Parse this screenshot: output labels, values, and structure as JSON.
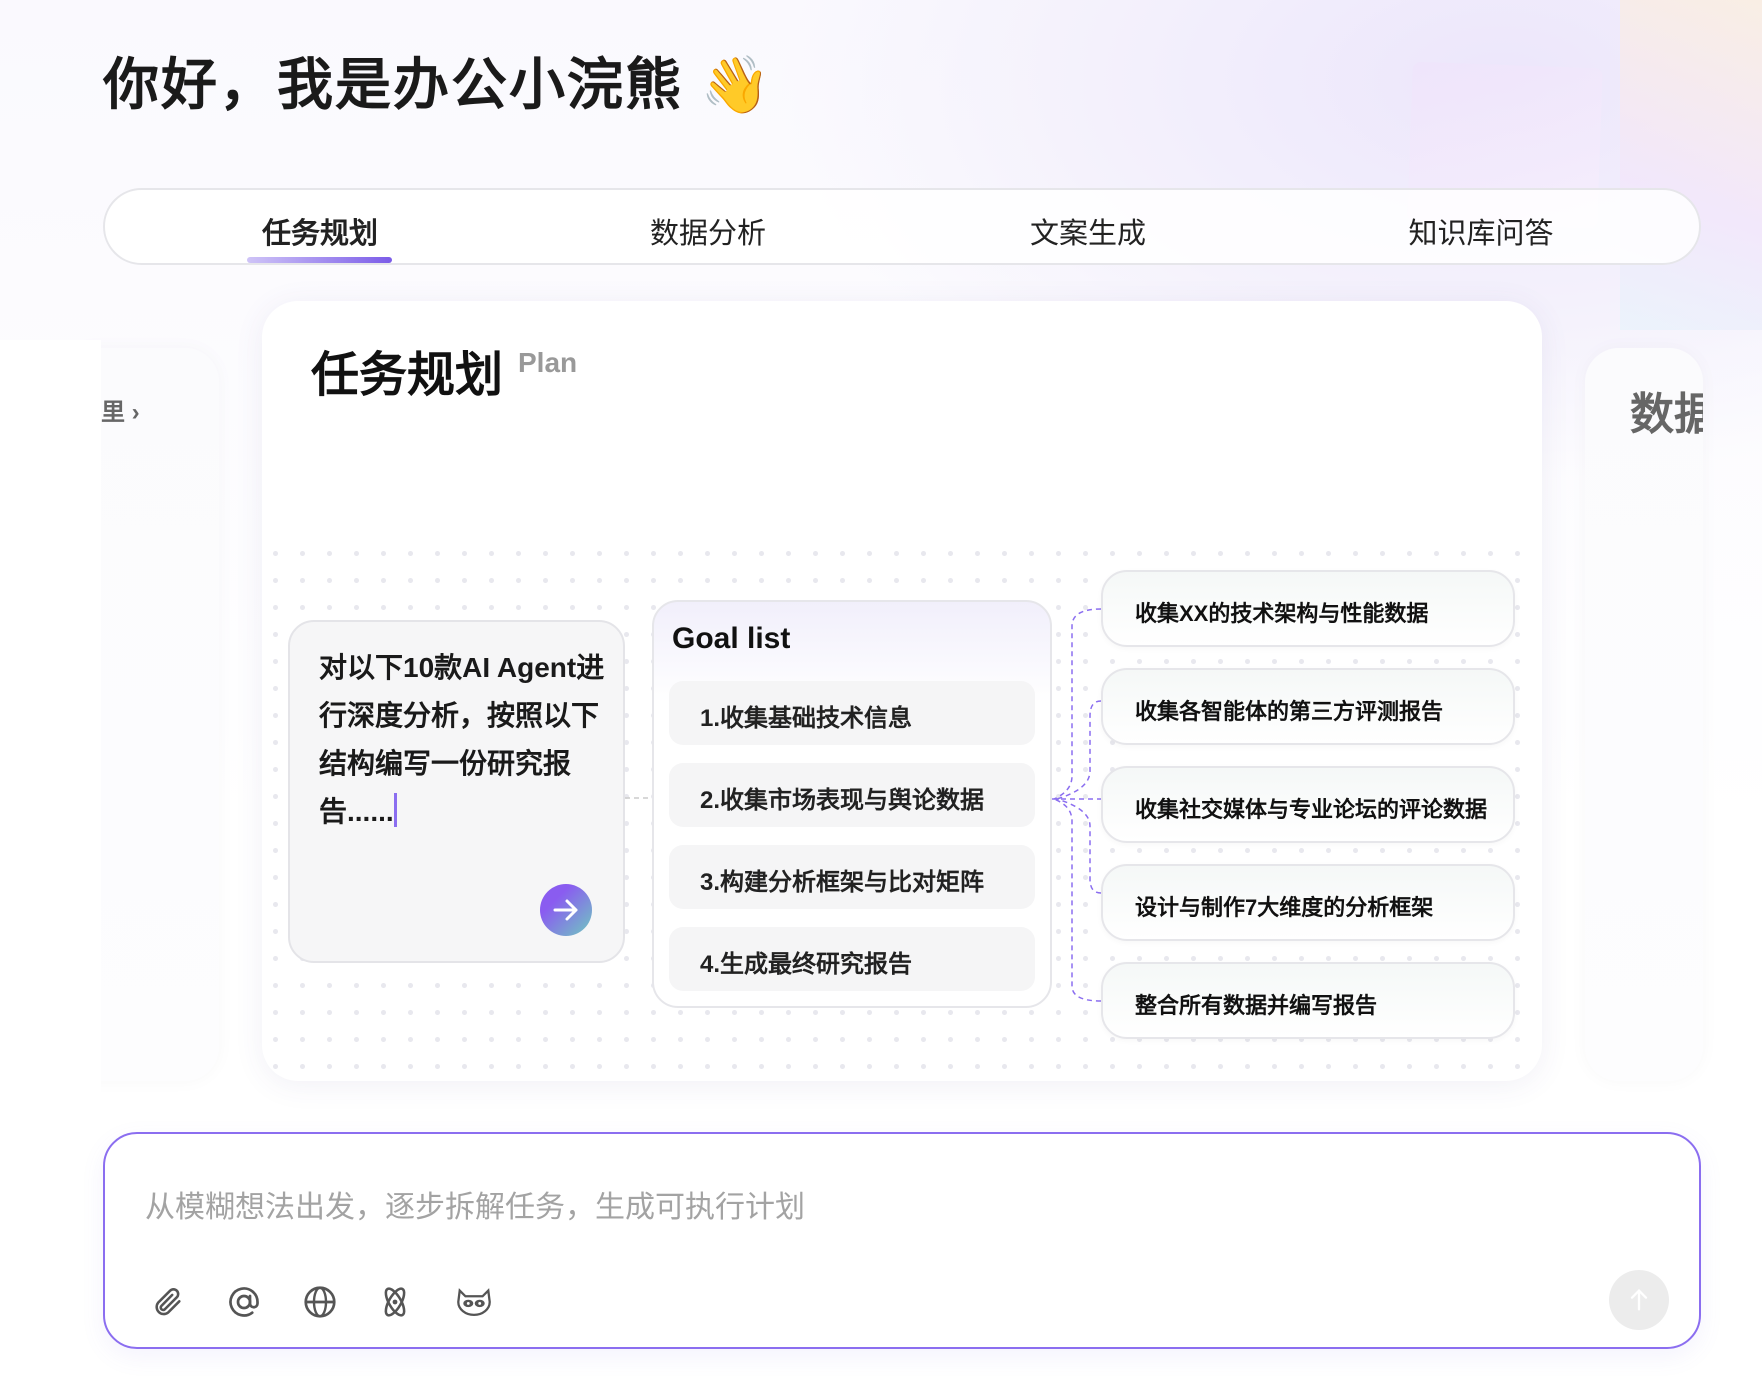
{
  "greeting": "你好，我是办公小浣熊 👋",
  "tabs": [
    {
      "label": "任务规划",
      "active": true
    },
    {
      "label": "数据分析"
    },
    {
      "label": "文案生成"
    },
    {
      "label": "知识库问答"
    }
  ],
  "carousel": {
    "prev_card_label": "里 ›",
    "next_card_label": "数据",
    "current": {
      "title": "任务规划",
      "subtitle": "Plan",
      "prompt_text": "对以下10款AI Agent进行深度分析，按照以下结构编写一份研究报告......",
      "goal_list_title": "Goal list",
      "goals": [
        "1.收集基础技术信息",
        "2.收集市场表现与舆论数据",
        "3.构建分析框架与比对矩阵",
        "4.生成最终研究报告"
      ],
      "steps": [
        "收集XX的技术架构与性能数据",
        "收集各智能体的第三方评测报告",
        "收集社交媒体与专业论坛的评论数据",
        "设计与制作7大维度的分析框架",
        "整合所有数据并编写报告"
      ]
    }
  },
  "input": {
    "placeholder": "从模糊想法出发，逐步拆解任务，生成可执行计划",
    "tools": [
      "paperclip-icon",
      "at-icon",
      "globe-icon",
      "atom-icon",
      "raccoon-icon"
    ]
  },
  "colors": {
    "accent": "#8b6ef0"
  }
}
